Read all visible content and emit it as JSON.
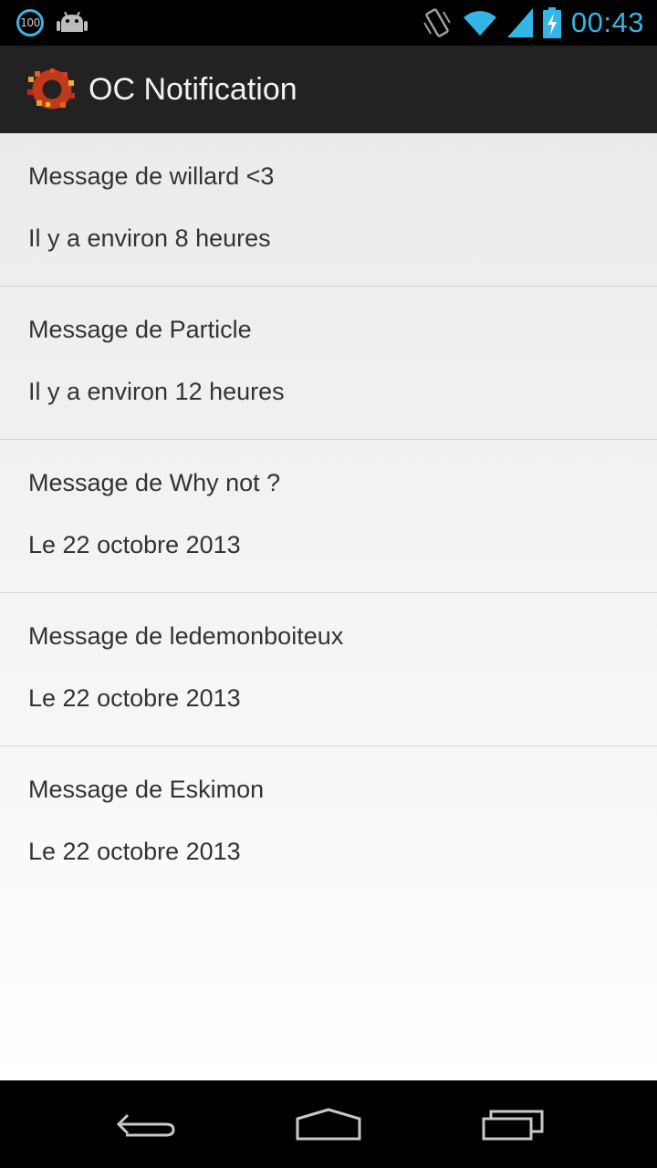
{
  "status_bar": {
    "battery_badge": "100",
    "clock": "00:43",
    "icons": [
      "battery-level-badge-icon",
      "android-icon",
      "vibrate-icon",
      "wifi-icon",
      "signal-icon",
      "battery-charging-icon"
    ]
  },
  "colors": {
    "accent": "#33b5e5",
    "action_bar": "#222222",
    "list_text": "#333333",
    "divider": "#d4d4d4"
  },
  "action_bar": {
    "title": "OC Notification",
    "logo_icon": "oc-logo-icon"
  },
  "messages": [
    {
      "title": "Message de willard <3",
      "date": "Il y a environ 8 heures"
    },
    {
      "title": "Message de Particle",
      "date": "Il y a environ 12 heures"
    },
    {
      "title": "Message de Why not ?",
      "date": "Le 22 octobre 2013"
    },
    {
      "title": "Message de ledemonboiteux",
      "date": "Le 22 octobre 2013"
    },
    {
      "title": "Message de Eskimon",
      "date": "Le 22 octobre 2013"
    }
  ],
  "nav_bar": {
    "buttons": [
      "back-icon",
      "home-icon",
      "recent-apps-icon"
    ]
  }
}
